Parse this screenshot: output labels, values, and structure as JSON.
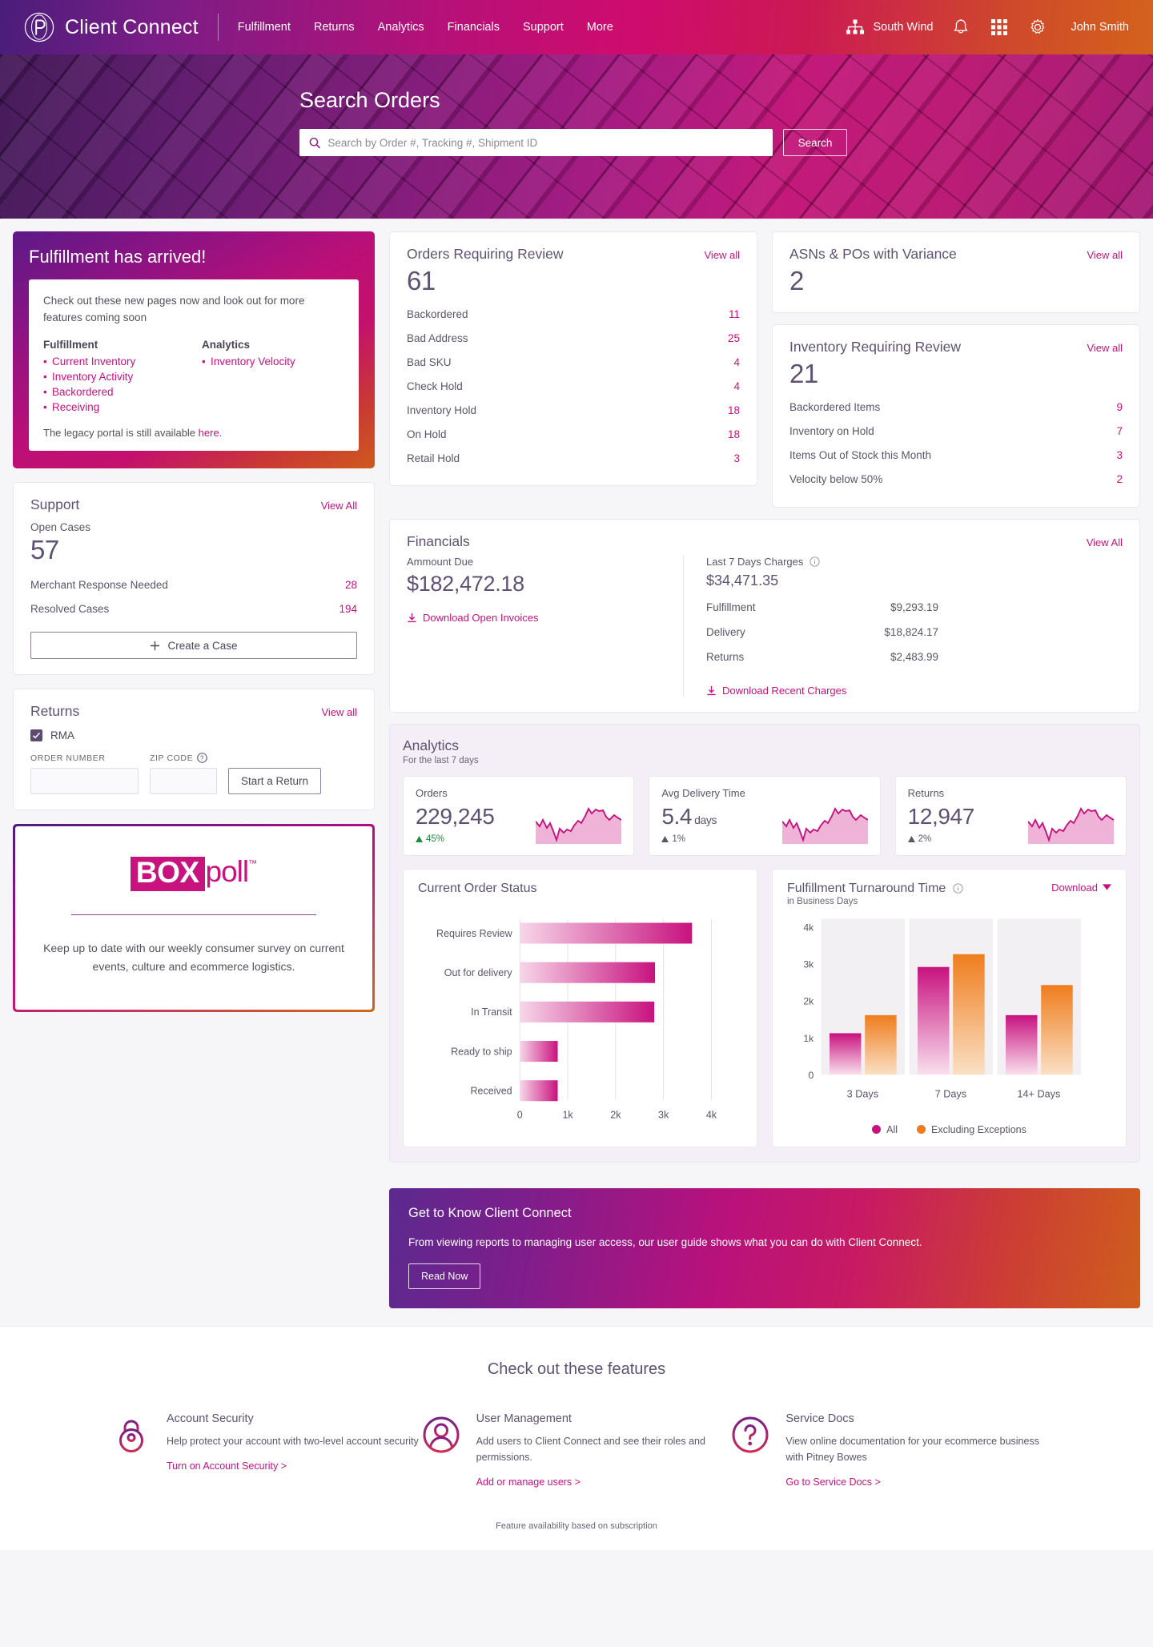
{
  "header": {
    "brand": "Client Connect",
    "nav": [
      "Fulfillment",
      "Returns",
      "Analytics",
      "Financials",
      "Support",
      "More"
    ],
    "org": "South Wind",
    "user": "John Smith",
    "icons": [
      "org-hierarchy-icon",
      "bell-icon",
      "apps-grid-icon",
      "gear-icon"
    ]
  },
  "hero": {
    "title": "Search Orders",
    "placeholder": "Search by Order #, Tracking #, Shipment ID",
    "value": "",
    "button": "Search"
  },
  "promo": {
    "title": "Fulfillment has arrived!",
    "lead": "Check out these new pages now and look out for more features coming soon",
    "columns": [
      {
        "heading": "Fulfillment",
        "items": [
          "Current Inventory",
          "Inventory Activity",
          "Backordered",
          "Receiving"
        ]
      },
      {
        "heading": "Analytics",
        "items": [
          "Inventory Velocity"
        ]
      }
    ],
    "footer_prefix": "The legacy portal is still available ",
    "footer_link": "here",
    "footer_suffix": "."
  },
  "support": {
    "title": "Support",
    "view_all": "View All",
    "open_label": "Open Cases",
    "open_value": "57",
    "rows": [
      {
        "label": "Merchant Response Needed",
        "value": "28"
      },
      {
        "label": "Resolved Cases",
        "value": "194"
      }
    ],
    "create_button": "Create a Case"
  },
  "returns": {
    "title": "Returns",
    "view_all": "View all",
    "rma_label": "RMA",
    "rma_checked": true,
    "order_number_label": "ORDER NUMBER",
    "order_number_value": "",
    "zip_label": "ZIP CODE",
    "zip_value": "",
    "start_button": "Start a Return"
  },
  "boxpoll": {
    "logo_box": "BOX",
    "logo_poll": "poll",
    "tm": "™",
    "description": "Keep up to date with our weekly consumer survey on current events, culture and ecommerce logistics."
  },
  "orders_review": {
    "title": "Orders Requiring Review",
    "view_all": "View all",
    "total": "61",
    "rows": [
      {
        "label": "Backordered",
        "value": "11"
      },
      {
        "label": "Bad Address",
        "value": "25"
      },
      {
        "label": "Bad SKU",
        "value": "4"
      },
      {
        "label": "Check Hold",
        "value": "4"
      },
      {
        "label": "Inventory Hold",
        "value": "18"
      },
      {
        "label": "On Hold",
        "value": "18"
      },
      {
        "label": "Retail Hold",
        "value": "3"
      }
    ]
  },
  "asn_pos": {
    "title": "ASNs & POs with Variance",
    "view_all": "View all",
    "total": "2"
  },
  "inventory_review": {
    "title": "Inventory Requiring Review",
    "view_all": "View all",
    "total": "21",
    "rows": [
      {
        "label": "Backordered Items",
        "value": "9"
      },
      {
        "label": "Inventory on Hold",
        "value": "7"
      },
      {
        "label": "Items Out of Stock this Month",
        "value": "3"
      },
      {
        "label": "Velocity below 50%",
        "value": "2"
      }
    ]
  },
  "financials": {
    "title": "Financials",
    "view_all": "View All",
    "amount_due_label": "Ammount Due",
    "amount_due": "$182,472.18",
    "download_open": "Download Open Invoices",
    "last7_label": "Last 7 Days Charges",
    "last7_value": "$34,471.35",
    "rows": [
      {
        "label": "Fulfillment",
        "value": "$9,293.19"
      },
      {
        "label": "Delivery",
        "value": "$18,824.17"
      },
      {
        "label": "Returns",
        "value": "$2,483.99"
      }
    ],
    "download_recent": "Download Recent Charges"
  },
  "analytics": {
    "title": "Analytics",
    "subtitle": "For the last 7 days",
    "cards": [
      {
        "label": "Orders",
        "value": "229,245",
        "unit": "",
        "delta": "45%",
        "delta_dir": "up",
        "delta_color": "#1e8a3c"
      },
      {
        "label": "Avg Delivery Time",
        "value": "5.4",
        "unit": "days",
        "delta": "1%",
        "delta_dir": "up",
        "delta_color": "#5d5468"
      },
      {
        "label": "Returns",
        "value": "12,947",
        "unit": "",
        "delta": "2%",
        "delta_dir": "up",
        "delta_color": "#5d5468"
      }
    ]
  },
  "chart_data": [
    {
      "type": "bar",
      "orientation": "horizontal",
      "title": "Current Order Status",
      "categories": [
        "Requires Review",
        "Out for delivery",
        "In Transit",
        "Ready to ship",
        "Received"
      ],
      "values": [
        3600,
        2820,
        2810,
        790,
        790
      ],
      "xlabel": "",
      "ylabel": "",
      "xlim": [
        0,
        4000
      ],
      "ticks": [
        "0",
        "1k",
        "2k",
        "3k",
        "4k"
      ],
      "grid": true,
      "bar_gradient_from": "#f5cde4",
      "bar_gradient_to": "#c8127e"
    },
    {
      "type": "bar",
      "orientation": "vertical",
      "title": "Fulfillment Turnaround Time",
      "subtitle": "in Business Days",
      "categories": [
        "3 Days",
        "7 Days",
        "14+ Days"
      ],
      "series": [
        {
          "name": "All",
          "values": [
            1130,
            2930,
            1620
          ],
          "color": "#c8127e"
        },
        {
          "name": "Excluding Exceptions",
          "values": [
            1620,
            3280,
            2450
          ],
          "color": "#ee7b1e"
        }
      ],
      "ylim": [
        0,
        4000
      ],
      "yticks": [
        "0",
        "1k",
        "2k",
        "3k",
        "4k"
      ],
      "legend": [
        "All",
        "Excluding Exceptions"
      ],
      "legend_position": "bottom",
      "download_label": "Download"
    }
  ],
  "guide": {
    "title": "Get to Know Client Connect",
    "body": "From viewing reports to managing user access,  our user guide shows what you can do  with Client Connect.",
    "button": "Read Now"
  },
  "footer": {
    "heading": "Check out these features",
    "features": [
      {
        "icon": "lock-icon",
        "title": "Account Security",
        "desc": "Help protect your account with two-level account security",
        "link": "Turn on Account Security >"
      },
      {
        "icon": "user-circle-icon",
        "title": "User Management",
        "desc": "Add users to Client Connect and see their roles and permissions.",
        "link": "Add or manage users >"
      },
      {
        "icon": "question-circle-icon",
        "title": "Service Docs",
        "desc": "View online documentation for your ecommerce business with Pitney Bowes",
        "link": "Go to Service Docs >"
      }
    ],
    "note": "Feature availability based on subscription"
  },
  "colors": {
    "magenta": "#c8127e",
    "purple": "#5e5270",
    "orange": "#ee7b1e",
    "green": "#1e8a3c"
  }
}
